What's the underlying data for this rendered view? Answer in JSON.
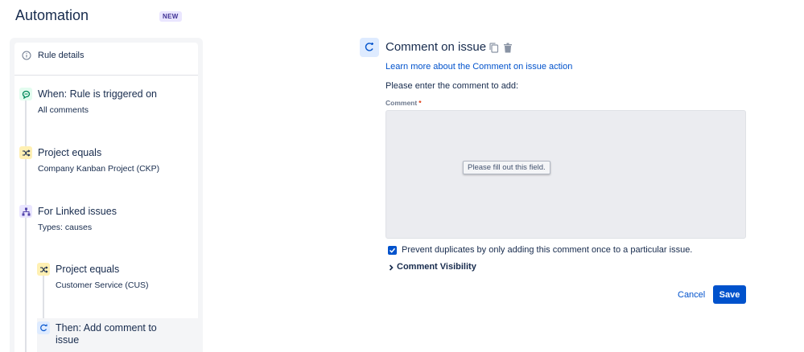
{
  "header": {
    "title": "Automation",
    "badge": "NEW"
  },
  "rule_panel": {
    "details_label": "Rule details",
    "steps": [
      {
        "icon": "speech-bubble-icon",
        "color": "#36b37e",
        "title": "When: Rule is triggered on",
        "subtitle": "All comments"
      },
      {
        "icon": "shuffle-icon",
        "color": "#ff991f",
        "title": "Project equals",
        "subtitle": "Company Kanban Project (CKP)"
      },
      {
        "icon": "hierarchy-icon",
        "color": "#6554c0",
        "title": "For Linked issues",
        "subtitle": "Types: causes"
      },
      {
        "icon": "shuffle-icon",
        "color": "#ff991f",
        "title": "Project equals",
        "subtitle": "Customer Service (CUS)"
      },
      {
        "icon": "add-comment-icon",
        "color": "#0052cc",
        "title": "Then: Add comment to issue",
        "subtitle": ""
      }
    ]
  },
  "editor": {
    "title": "Comment on issue",
    "learn_more": "Learn more about the Comment on issue action",
    "instruction": "Please enter the comment to add:",
    "comment_label": "Comment",
    "required_marker": "*",
    "comment_value": "",
    "validation_tooltip": "Please fill out this field.",
    "prevent_duplicates_label": "Prevent duplicates by only adding this comment once to a particular issue.",
    "prevent_duplicates_checked": true,
    "visibility_label": "Comment Visibility",
    "cancel_label": "Cancel",
    "save_label": "Save"
  },
  "colors": {
    "primary": "#0052cc",
    "text": "#172b4d",
    "required": "#de350b"
  }
}
